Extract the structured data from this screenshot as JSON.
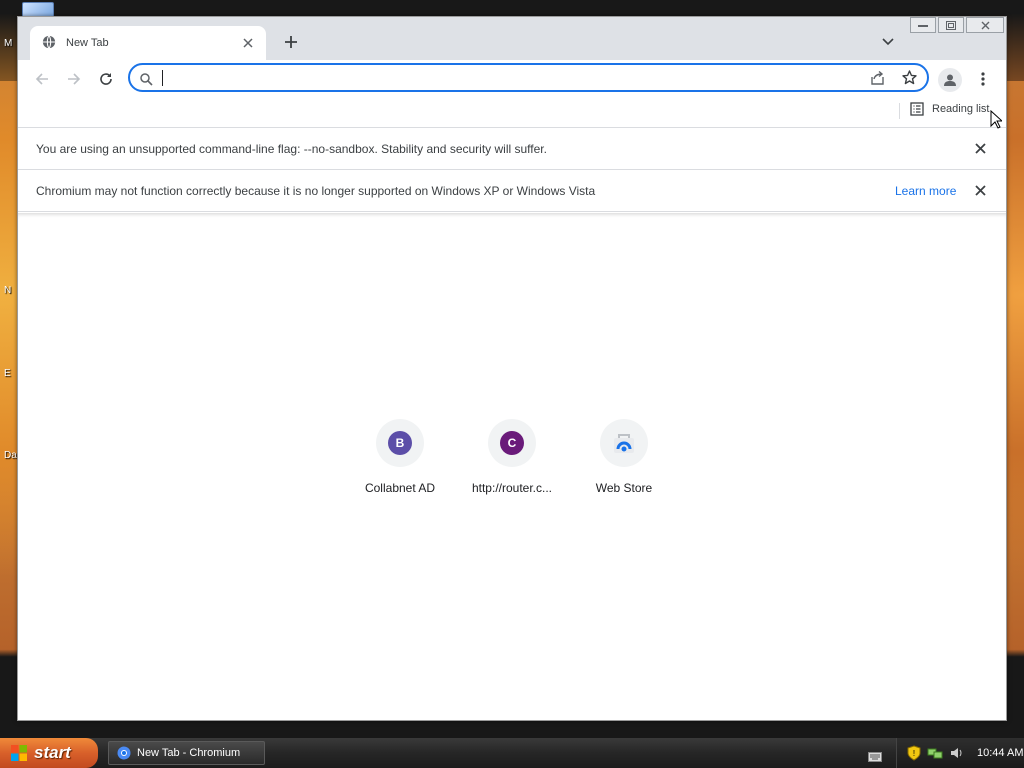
{
  "desktop": {
    "labels": [
      "M",
      "N",
      "E",
      "Da"
    ]
  },
  "browser": {
    "tab": {
      "title": "New Tab",
      "icon": "globe-icon"
    },
    "new_tab_icon": "plus-icon",
    "tab_search_icon": "chevron-down-icon",
    "window_controls": [
      "minimize",
      "maximize",
      "close"
    ],
    "toolbar": {
      "back_icon": "back-arrow-icon",
      "forward_icon": "forward-arrow-icon",
      "reload_icon": "reload-icon",
      "omnibox": {
        "value": "",
        "placeholder": ""
      }
    },
    "bookmarks_bar": {
      "reading_list_label": "Reading list"
    },
    "infobars": [
      {
        "text": "You are using an unsupported command-line flag: --no-sandbox. Stability and security will suffer.",
        "link": ""
      },
      {
        "text": "Chromium may not function correctly because it is no longer supported on Windows XP or Windows Vista",
        "link": "Learn more"
      }
    ],
    "shortcuts": [
      {
        "label": "Collabnet AD",
        "letter": "B",
        "color": "#5c4ea8"
      },
      {
        "label": "http://router.c...",
        "letter": "C",
        "color": "#6a1b7a"
      },
      {
        "label": "Web Store",
        "letter": "",
        "color": "#1a73e8"
      }
    ]
  },
  "taskbar": {
    "start_label": "start",
    "task_label": "New Tab - Chromium",
    "clock": "10:44 AM"
  }
}
